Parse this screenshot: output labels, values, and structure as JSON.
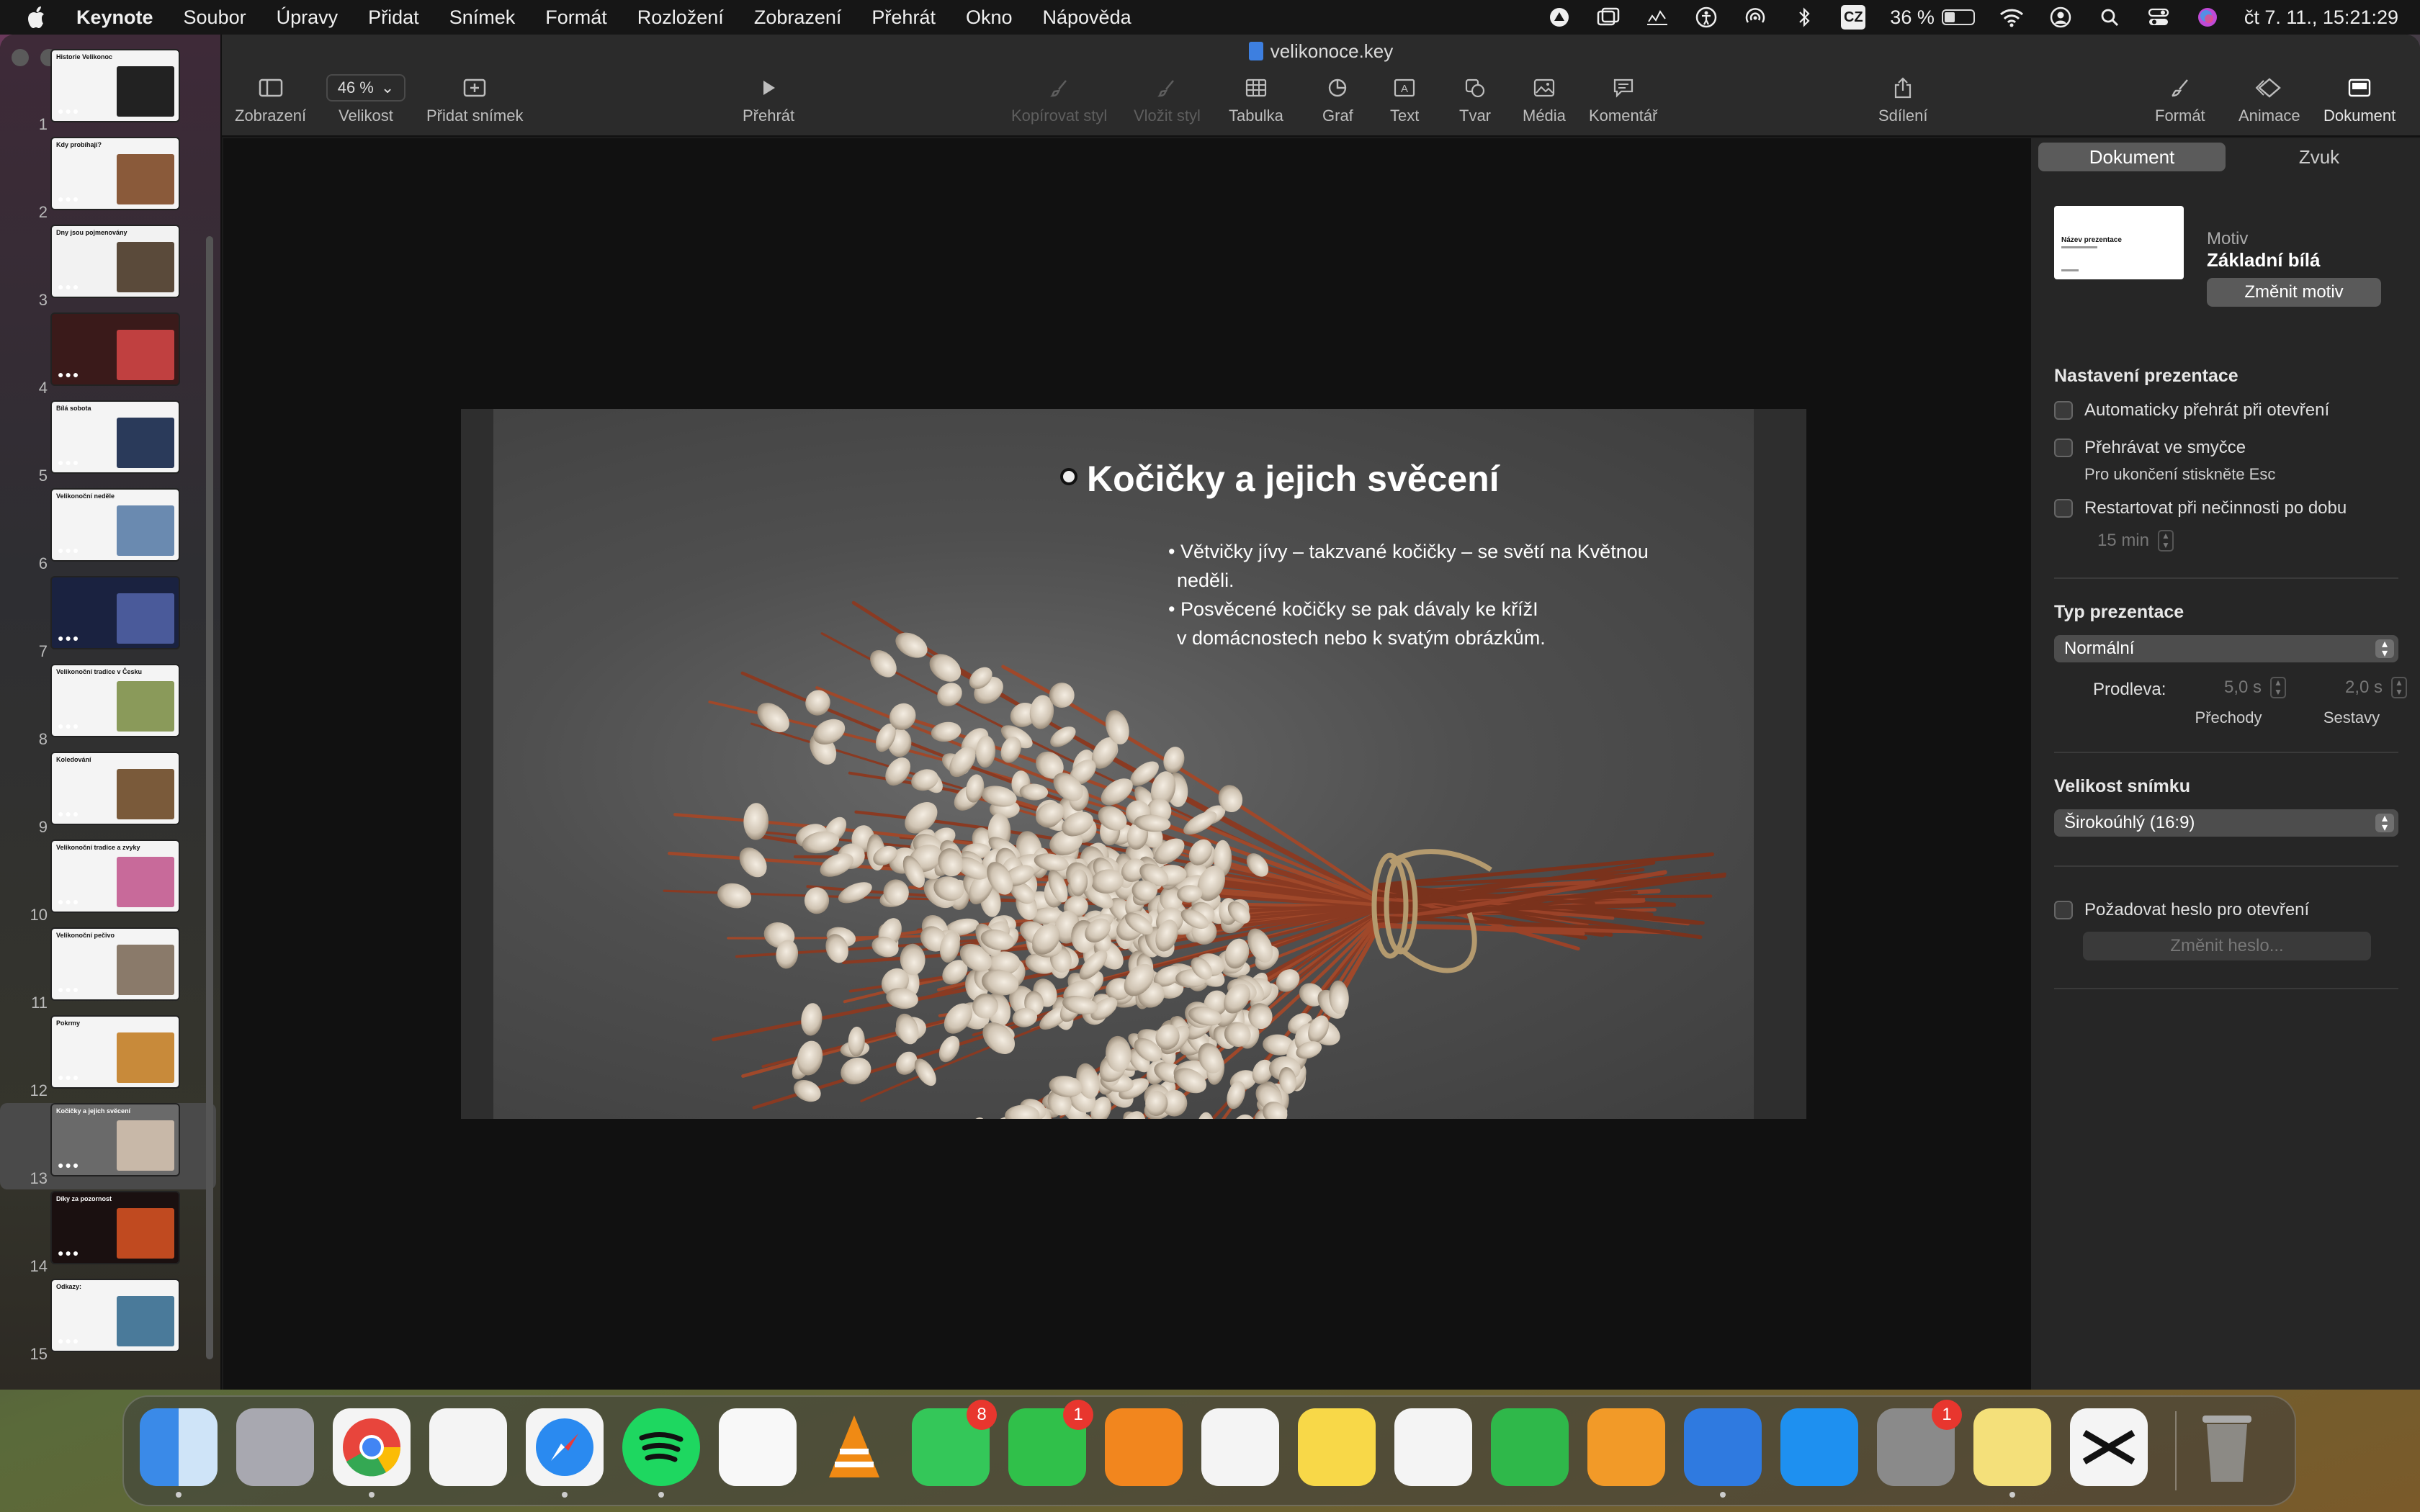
{
  "menubar": {
    "app": "Keynote",
    "items": [
      "Soubor",
      "Úpravy",
      "Přidat",
      "Snímek",
      "Formát",
      "Rozložení",
      "Zobrazení",
      "Přehrát",
      "Okno",
      "Nápověda"
    ],
    "input_source": "CZ",
    "battery": "36 %",
    "battery_level": 0.36,
    "clock": "čt 7. 11., 15:21:29"
  },
  "window": {
    "title": "velikonoce.key"
  },
  "toolbar": {
    "view": "Zobrazení",
    "zoom_value": "46 %",
    "zoom": "Velikost",
    "add_slide": "Přidat snímek",
    "play": "Přehrát",
    "copy_style": "Kopírovat styl",
    "paste_style": "Vložit styl",
    "table": "Tabulka",
    "chart": "Graf",
    "text": "Text",
    "shape": "Tvar",
    "media": "Média",
    "comment": "Komentář",
    "share": "Sdílení",
    "format": "Formát",
    "animate": "Animace",
    "document": "Dokument"
  },
  "slides": [
    {
      "num": "1",
      "thumb": "Historie Velikonoc"
    },
    {
      "num": "2",
      "thumb": "Kdy probíhají?"
    },
    {
      "num": "3",
      "thumb": "Dny jsou pojmenovány"
    },
    {
      "num": "4",
      "thumb": ""
    },
    {
      "num": "5",
      "thumb": "Bílá sobota"
    },
    {
      "num": "6",
      "thumb": "Velikonoční neděle"
    },
    {
      "num": "7",
      "thumb": ""
    },
    {
      "num": "8",
      "thumb": "Velikonoční tradice v Česku"
    },
    {
      "num": "9",
      "thumb": "Koledování"
    },
    {
      "num": "10",
      "thumb": "Velikonoční tradice a zvyky"
    },
    {
      "num": "11",
      "thumb": "Velikonoční pečivo"
    },
    {
      "num": "12",
      "thumb": "Pokrmy"
    },
    {
      "num": "13",
      "thumb": "Kočičky a jejich svěcení"
    },
    {
      "num": "14",
      "thumb": "Díky za pozornost"
    },
    {
      "num": "15",
      "thumb": "Odkazy:"
    }
  ],
  "slide": {
    "title": "Kočičky a jejich svěcení",
    "bullet1_line1": "• Větvičky jívy – takzvané kočičky – se světí na Květnou",
    "bullet1_line2": "neděli.",
    "bullet2_line1": "• Posvěcené kočičky se pak dávaly ke křížI",
    "bullet2_line2": "v domácnostech nebo k svatým obrázkům."
  },
  "inspector": {
    "tab_document": "Dokument",
    "tab_audio": "Zvuk",
    "theme_label": "Motiv",
    "theme_name": "Základní bílá",
    "theme_thumb_title": "Název prezentace",
    "change_theme": "Změnit motiv",
    "settings_head": "Nastavení prezentace",
    "auto_play": "Automaticky přehrát při otevření",
    "loop": "Přehrávat ve smyčce",
    "loop_hint": "Pro ukončení stiskněte Esc",
    "restart": "Restartovat při nečinnosti po dobu",
    "restart_value": "15 min",
    "type_head": "Typ prezentace",
    "type_value": "Normální",
    "delay_label": "Prodleva:",
    "transitions_value": "5,0 s",
    "builds_value": "2,0 s",
    "transitions_label": "Přechody",
    "builds_label": "Sestavy",
    "size_head": "Velikost snímku",
    "size_value": "Širokoúhlý (16:9)",
    "password": "Požadovat heslo pro otevření",
    "change_password": "Změnit heslo..."
  },
  "dock": {
    "apps": [
      {
        "name": "finder",
        "badge": ""
      },
      {
        "name": "launchpad",
        "badge": ""
      },
      {
        "name": "chrome",
        "badge": ""
      },
      {
        "name": "messenger",
        "badge": ""
      },
      {
        "name": "safari",
        "badge": ""
      },
      {
        "name": "spotify",
        "badge": ""
      },
      {
        "name": "photos",
        "badge": ""
      },
      {
        "name": "vlc",
        "badge": ""
      },
      {
        "name": "messages",
        "badge": "8"
      },
      {
        "name": "facetime",
        "badge": "1"
      },
      {
        "name": "books",
        "badge": ""
      },
      {
        "name": "reminders",
        "badge": ""
      },
      {
        "name": "notes",
        "badge": ""
      },
      {
        "name": "freeform",
        "badge": ""
      },
      {
        "name": "numbers",
        "badge": ""
      },
      {
        "name": "pages",
        "badge": ""
      },
      {
        "name": "keynote",
        "badge": ""
      },
      {
        "name": "app-store",
        "badge": ""
      },
      {
        "name": "system-settings",
        "badge": "1"
      },
      {
        "name": "stickies",
        "badge": ""
      },
      {
        "name": "capcut",
        "badge": ""
      },
      {
        "name": "trash",
        "badge": ""
      }
    ]
  }
}
